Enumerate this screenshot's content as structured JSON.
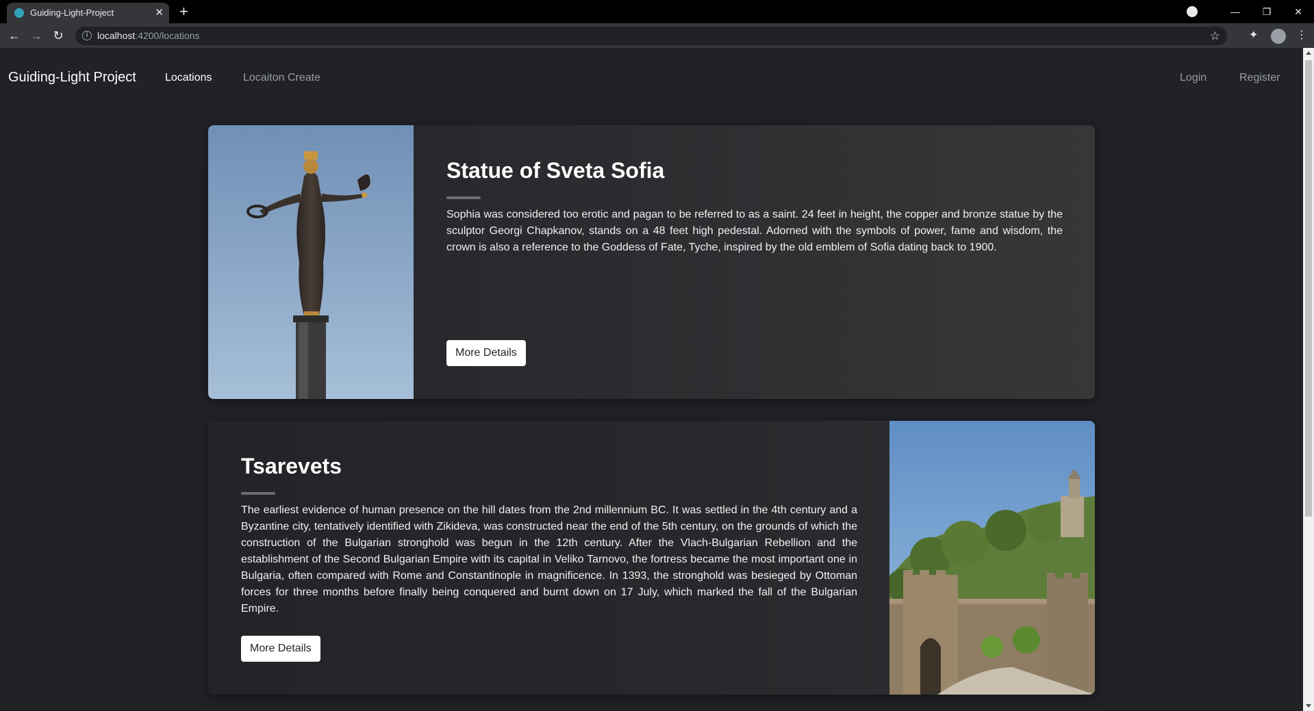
{
  "browser": {
    "tab_title": "Guiding-Light-Project",
    "tab_close": "✕",
    "new_tab": "+",
    "url_host": "localhost",
    "url_rest": ":4200/locations",
    "back": "←",
    "forward": "→",
    "reload": "↻",
    "star": "☆",
    "extensions": "✦",
    "menu": "⋮",
    "minimize": "—",
    "restore": "❐",
    "close": "✕"
  },
  "navbar": {
    "brand": "Guiding-Light Project",
    "links": [
      "Locations",
      "Locaiton Create"
    ],
    "login": "Login",
    "register": "Register"
  },
  "locations": [
    {
      "title": "Statue of Sveta Sofia",
      "description": "Sophia was considered too erotic and pagan to be referred to as a saint. 24 feet in height, the copper and bronze statue by the sculptor Georgi Chapkanov, stands on a 48 feet high pedestal. Adorned with the symbols of power, fame and wisdom, the crown is also a reference to the Goddess of Fate, Tyche, inspired by the old emblem of Sofia dating back to 1900.",
      "button": "More Details",
      "image_side": "left"
    },
    {
      "title": "Tsarevets",
      "description": "The earliest evidence of human presence on the hill dates from the 2nd millennium BC. It was settled in the 4th century and a Byzantine city, tentatively identified with Zikideva, was constructed near the end of the 5th century, on the grounds of which the construction of the Bulgarian stronghold was begun in the 12th century. After the Vlach-Bulgarian Rebellion and the establishment of the Second Bulgarian Empire with its capital in Veliko Tarnovo, the fortress became the most important one in Bulgaria, often compared with Rome and Constantinople in magnificence. In 1393, the stronghold was besieged by Ottoman forces for three months before finally being conquered and burnt down on 17 July, which marked the fall of the Bulgarian Empire.",
      "button": "More Details",
      "image_side": "right"
    }
  ],
  "colors": {
    "page_bg": "#202226",
    "card_bg": "#2b2c2f",
    "text": "#ffffff",
    "nav_muted": "#9a9da2"
  }
}
